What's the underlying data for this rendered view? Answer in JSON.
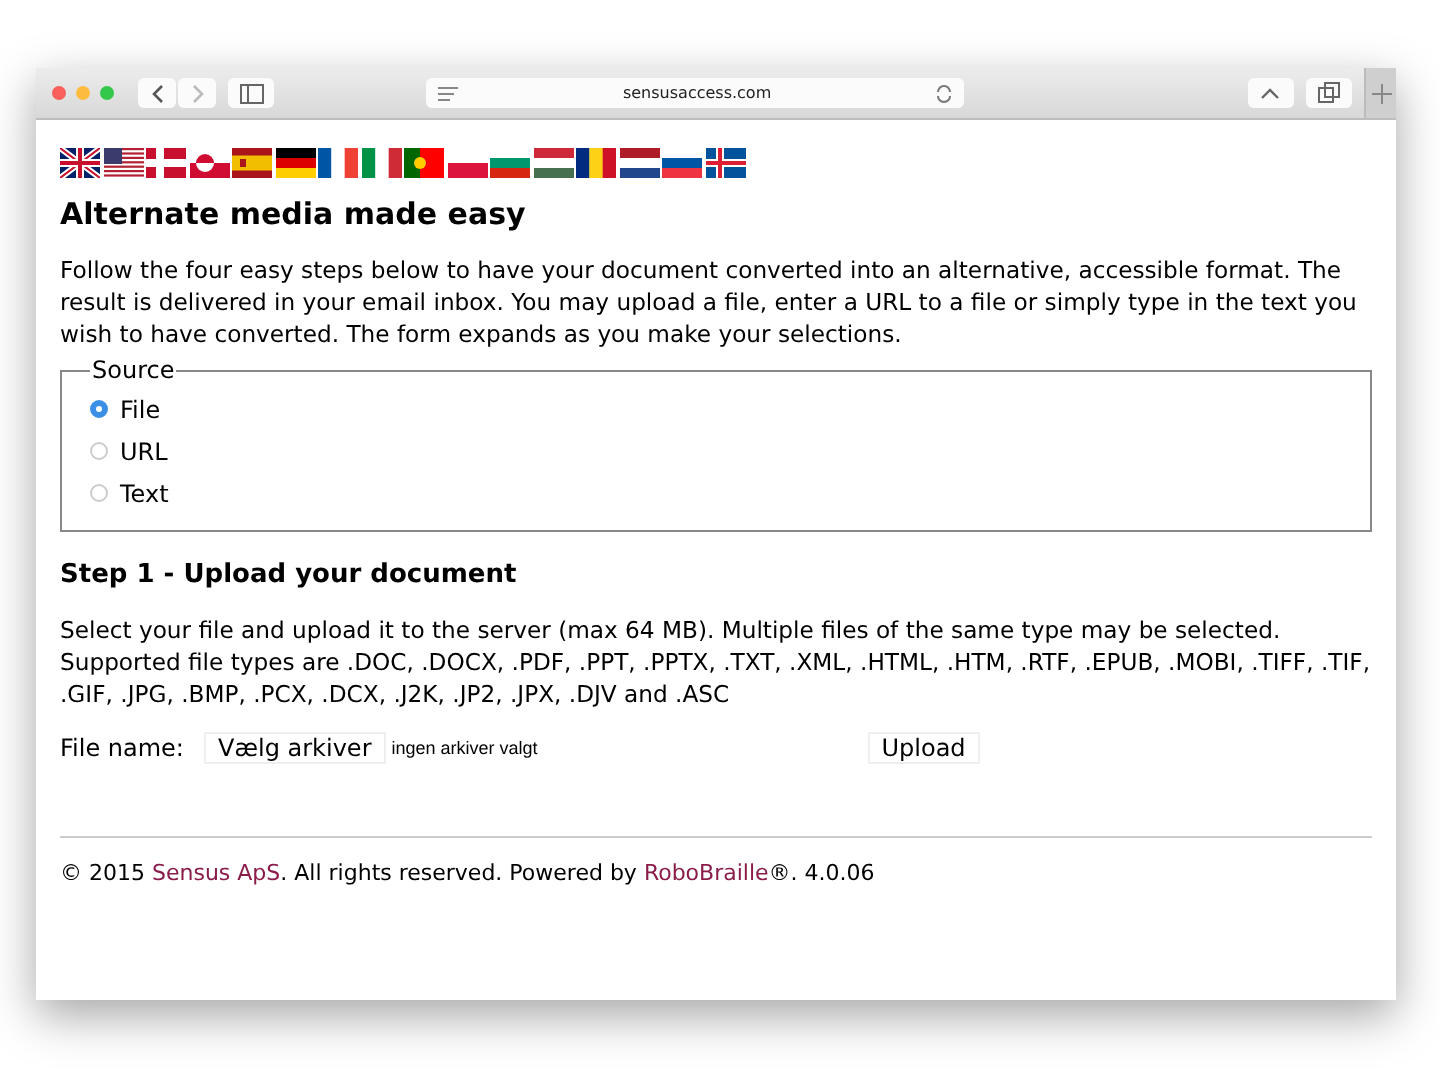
{
  "browser": {
    "address": "sensusaccess.com"
  },
  "flags": [
    {
      "kind": "uk"
    },
    {
      "kind": "us"
    },
    {
      "kind": "dk"
    },
    {
      "kind": "gl"
    },
    {
      "kind": "es"
    },
    {
      "kind": "de"
    },
    {
      "kind": "fr"
    },
    {
      "kind": "it"
    },
    {
      "kind": "pt"
    },
    {
      "kind": "pl"
    },
    {
      "kind": "bg"
    },
    {
      "kind": "hu"
    },
    {
      "kind": "ro"
    },
    {
      "kind": "nl"
    },
    {
      "kind": "si"
    },
    {
      "kind": "is"
    }
  ],
  "heading": "Alternate media made easy",
  "intro": "Follow the four easy steps below to have your document converted into an alternative, accessible format. The result is delivered in your email inbox. You may upload a file, enter a URL to a file or simply type in the text you wish to have converted. The form expands as you make your selections.",
  "source": {
    "legend": "Source",
    "options": [
      {
        "label": "File",
        "selected": true
      },
      {
        "label": "URL",
        "selected": false
      },
      {
        "label": "Text",
        "selected": false
      }
    ]
  },
  "step": {
    "title": "Step 1 - Upload your document",
    "description": "Select your file and upload it to the server (max 64 MB). Multiple files of the same type may be selected. Supported file types are .DOC, .DOCX, .PDF, .PPT, .PPTX, .TXT, .XML, .HTML, .HTM, .RTF, .EPUB, .MOBI, .TIFF, .TIF, .GIF, .JPG, .BMP, .PCX, .DCX, .J2K, .JP2, .JPX, .DJV and .ASC",
    "file_label": "File name:",
    "choose_button": "Vælg arkiver",
    "file_status": "ingen arkiver valgt",
    "upload_button": "Upload"
  },
  "footer": {
    "prefix": "© 2015",
    "company": "Sensus ApS",
    "middle": ". All rights reserved. Powered by",
    "product": "RoboBraille",
    "suffix": "®. 4.0.06"
  }
}
